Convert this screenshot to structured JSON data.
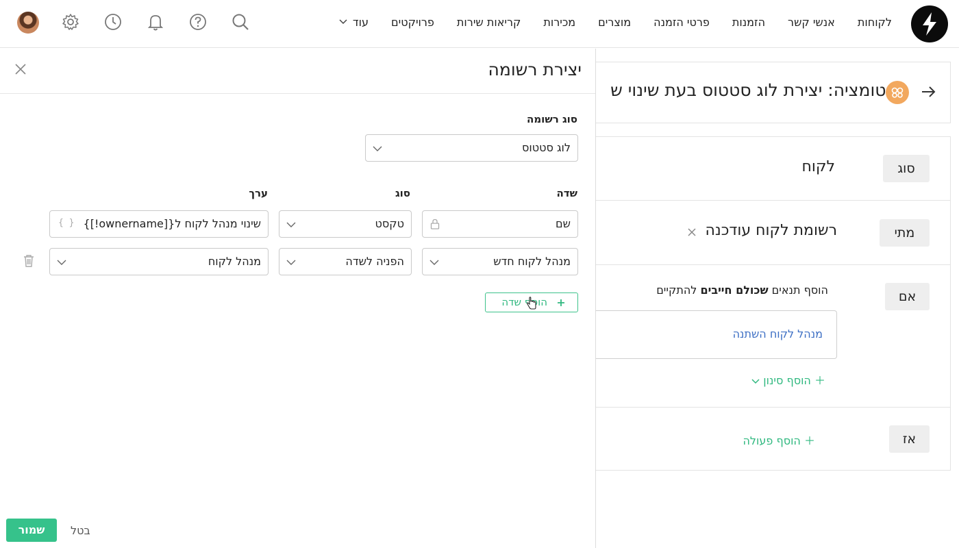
{
  "nav": {
    "items": [
      "לקוחות",
      "אנשי קשר",
      "הזמנות",
      "פרטי הזמנה",
      "מוצרים",
      "מכירות",
      "קריאות שירות",
      "פרויקטים"
    ],
    "more_label": "עוד"
  },
  "topbar_icons": [
    "search-icon",
    "help-icon",
    "bell-icon",
    "clock-icon",
    "gear-icon"
  ],
  "automation": {
    "title": "אוטומציה: יצירת לוג סטטוס בעת שינוי ש",
    "type_label": "סוג",
    "type_value": "לקוח",
    "when_label": "מתי",
    "when_value": "רשומת לקוח עודכנה",
    "if_label": "אם",
    "if_text_pre": "הוסף תנאים ",
    "if_text_bold": "שכולם חייבים",
    "if_text_post": " להתקיים",
    "condition_value": "מנהל לקוח השתנה",
    "add_filter": "הוסף סינון",
    "then_label": "אז",
    "add_action": "הוסף פעולה"
  },
  "drawer": {
    "title": "יצירת רשומה",
    "record_type_label": "סוג רשומה",
    "record_type_value": "לוג סטטוס",
    "col_field": "שדה",
    "col_type": "סוג",
    "col_value": "ערך",
    "rows": [
      {
        "field": "שם",
        "type": "טקסט",
        "value": "שינוי מנהל לקוח ל{[ownername!]}"
      },
      {
        "field": "מנהל לקוח חדש",
        "type": "הפניה לשדה",
        "value": "מנהל לקוח"
      }
    ],
    "add_field": "הוסף שדה",
    "save": "שמור",
    "cancel": "בטל"
  },
  "colors": {
    "accent_green": "#36c28b",
    "link_blue": "#3d6fc4",
    "badge_orange": "#f2a85e"
  }
}
